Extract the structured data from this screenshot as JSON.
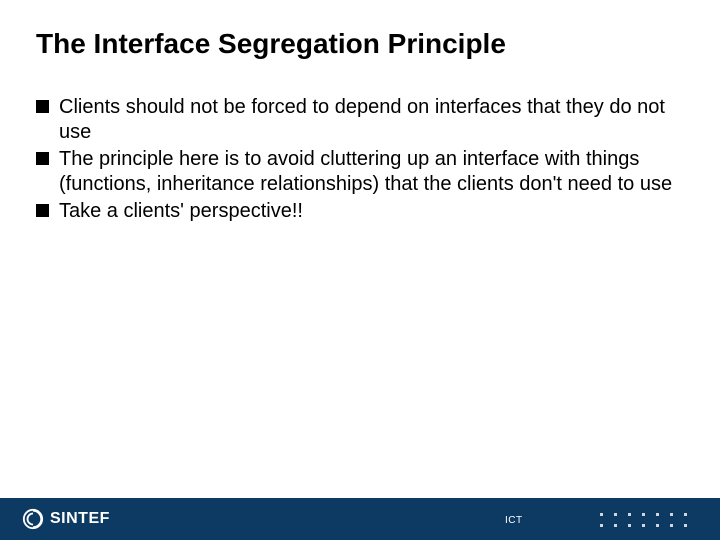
{
  "title": "The Interface Segregation Principle",
  "bullets": [
    "Clients should not be forced to depend on interfaces that they do not use",
    "The principle here is to avoid cluttering up an interface with things (functions, inheritance relationships) that the clients don't need to use",
    "Take a clients' perspective!!"
  ],
  "footer": {
    "brand": "SINTEF",
    "label": "ICT"
  },
  "colors": {
    "footer_bg": "#0d3a63"
  }
}
